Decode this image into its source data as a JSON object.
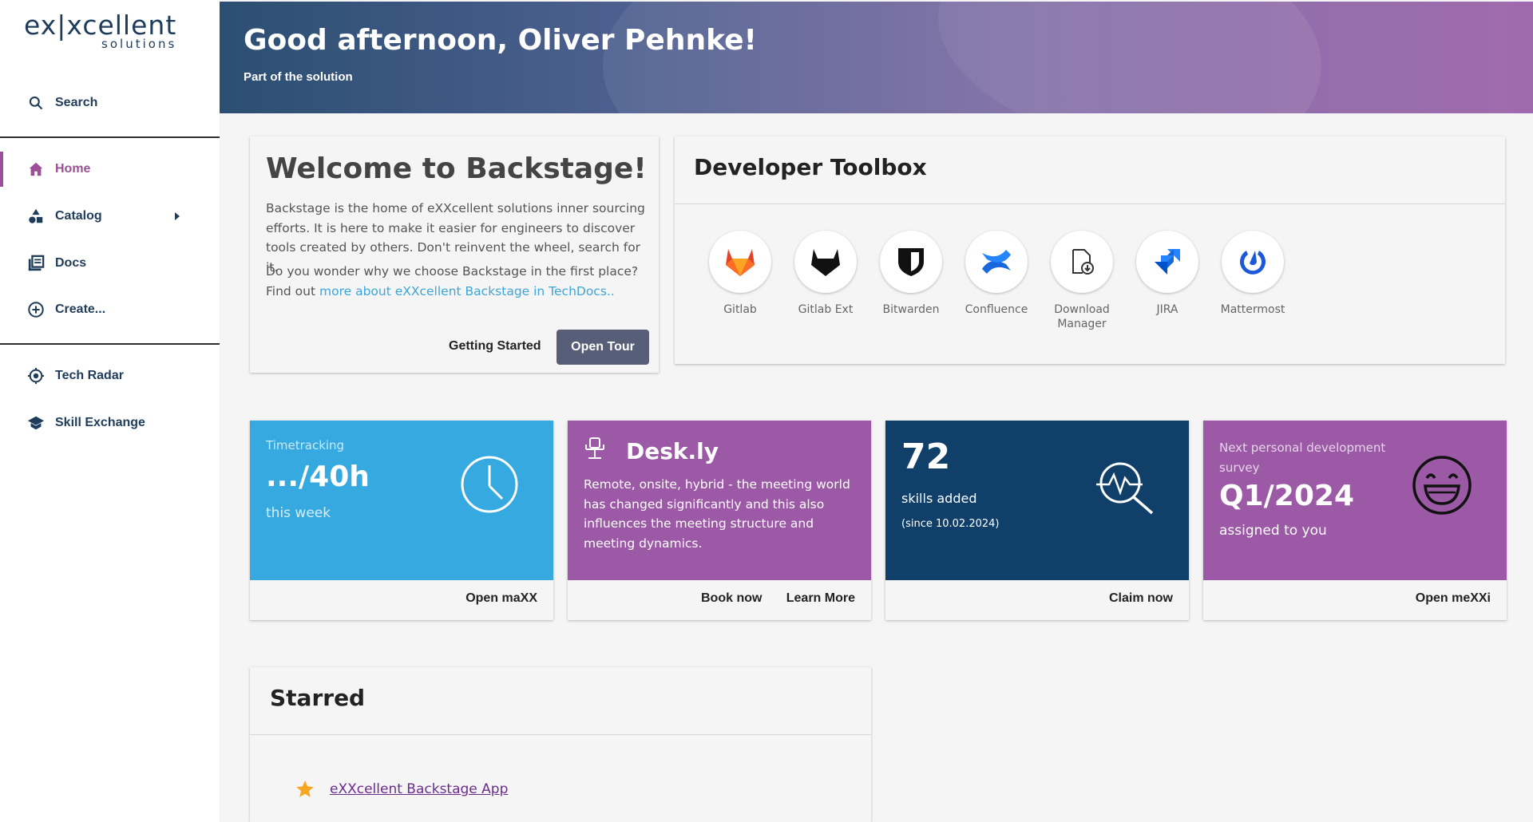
{
  "brand": {
    "logo_main": "ex|xcellent",
    "logo_sub": "solutions"
  },
  "sidebar": {
    "search": {
      "label": "Search",
      "icon": "search-icon"
    },
    "items": [
      {
        "label": "Home",
        "icon": "home-icon",
        "active": true
      },
      {
        "label": "Catalog",
        "icon": "catalog-icon"
      },
      {
        "label": "Docs",
        "icon": "docs-icon"
      },
      {
        "label": "Create...",
        "icon": "add-circle-icon"
      },
      {
        "label": "Tech Radar",
        "icon": "radar-icon"
      },
      {
        "label": "Skill Exchange",
        "icon": "graduation-cap-icon"
      }
    ]
  },
  "header": {
    "title": "Good afternoon, Oliver Pehnke!",
    "subtitle": "Part of the solution"
  },
  "welcome": {
    "title": "Welcome to Backstage!",
    "para1": "Backstage is the home of eXXcellent solutions inner sourcing efforts. It is here to make it easier for engineers to discover tools created by others. Don't reinvent the wheel, search for it.",
    "para2_prefix": "Do you wonder why we choose Backstage in the first place? Find out ",
    "para2_link": "more about eXXcellent Backstage in TechDocs",
    "para2_suffix": "..",
    "getting_started": "Getting Started",
    "open_tour": "Open Tour"
  },
  "toolbox": {
    "title": "Developer Toolbox",
    "tools": [
      {
        "name": "Gitlab",
        "icon": "gitlab-icon"
      },
      {
        "name": "Gitlab Ext",
        "icon": "gitlab-ext-icon"
      },
      {
        "name": "Bitwarden",
        "icon": "bitwarden-icon"
      },
      {
        "name": "Confluence",
        "icon": "confluence-icon"
      },
      {
        "name": "Download Manager",
        "icon": "download-manager-icon"
      },
      {
        "name": "JIRA",
        "icon": "jira-icon"
      },
      {
        "name": "Mattermost",
        "icon": "mattermost-icon"
      }
    ]
  },
  "tiles": {
    "timetracking": {
      "label": "Timetracking",
      "value": ".../40h",
      "period": "this week",
      "action": "Open maXX",
      "color": "#35a9e0",
      "icon": "clock-icon"
    },
    "deskly": {
      "title": "Desk.ly",
      "text": "Remote, onsite, hybrid - the meeting world has changed significantly and this also influences the meeting structure and meeting dynamics.",
      "action1": "Book now",
      "action2": "Learn More",
      "color": "#9b59a6",
      "icon": "desk-chair-icon"
    },
    "skills": {
      "value": "72",
      "label": "skills added",
      "since": "(since 10.02.2024)",
      "action": "Claim now",
      "color": "#10406a",
      "icon": "skill-search-icon"
    },
    "survey": {
      "label": "Next personal development survey",
      "value": "Q1/2024",
      "assigned": "assigned to you",
      "action": "Open meXXi",
      "color": "#9b59a6",
      "icon": "smiley-icon"
    }
  },
  "starred": {
    "title": "Starred",
    "items": [
      {
        "label": "eXXcellent Backstage App",
        "icon": "star-icon"
      }
    ]
  }
}
